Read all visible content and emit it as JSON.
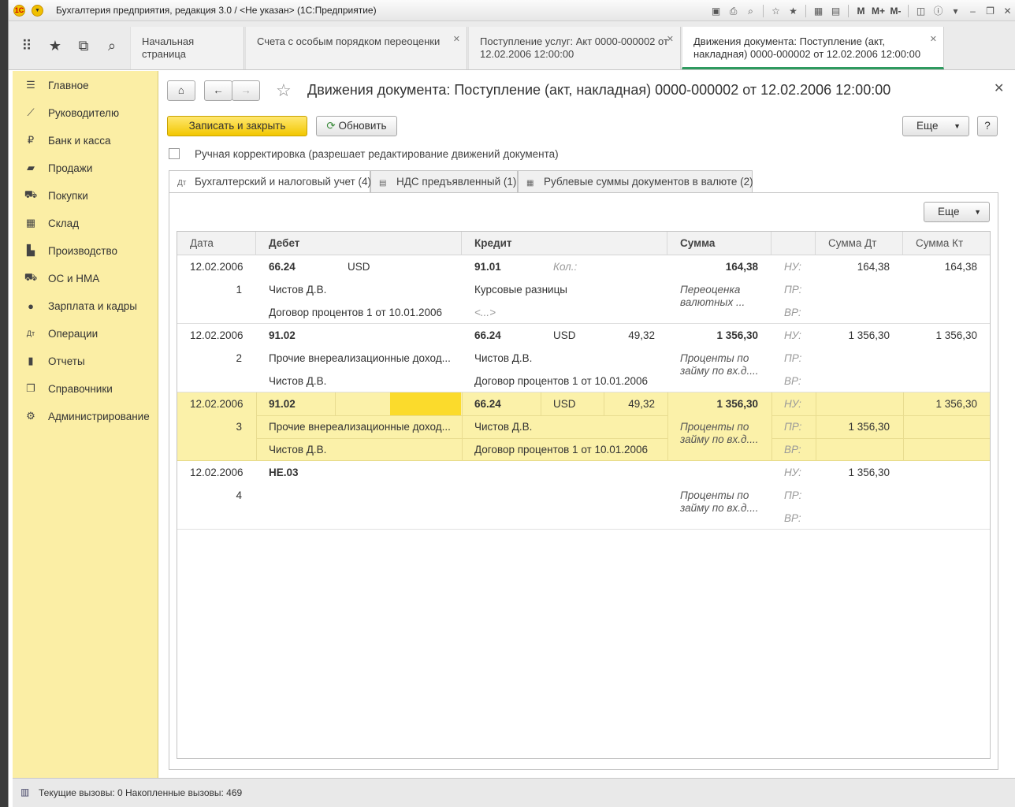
{
  "window": {
    "title": "Бухгалтерия предприятия, редакция 3.0 / <Не указан>  (1С:Предприятие)"
  },
  "toolbar_icons": [
    "M",
    "M+",
    "M-"
  ],
  "tabs": [
    {
      "label": "Начальная страница",
      "closable": false
    },
    {
      "label": "Счета с особым порядком переоценки",
      "closable": true
    },
    {
      "label": "Поступление услуг: Акт 0000-000002 от 12.02.2006 12:00:00",
      "closable": true
    },
    {
      "label": "Движения документа: Поступление (акт, накладная) 0000-000002 от 12.02.2006 12:00:00",
      "closable": true,
      "active": true
    }
  ],
  "sidebar": {
    "items": [
      {
        "label": "Главное",
        "icon": "menu-icon"
      },
      {
        "label": "Руководителю",
        "icon": "chart-line-icon"
      },
      {
        "label": "Банк и касса",
        "icon": "ruble-icon"
      },
      {
        "label": "Продажи",
        "icon": "bag-icon"
      },
      {
        "label": "Покупки",
        "icon": "cart-icon"
      },
      {
        "label": "Склад",
        "icon": "warehouse-icon"
      },
      {
        "label": "Производство",
        "icon": "factory-icon"
      },
      {
        "label": "ОС и НМА",
        "icon": "truck-icon"
      },
      {
        "label": "Зарплата и кадры",
        "icon": "person-icon"
      },
      {
        "label": "Операции",
        "icon": "dt-kt-icon"
      },
      {
        "label": "Отчеты",
        "icon": "bar-chart-icon"
      },
      {
        "label": "Справочники",
        "icon": "books-icon"
      },
      {
        "label": "Администрирование",
        "icon": "gear-icon"
      }
    ]
  },
  "document": {
    "title": "Движения документа: Поступление (акт, накладная) 0000-000002 от 12.02.2006 12:00:00",
    "save_close_label": "Записать и закрыть",
    "refresh_label": "Обновить",
    "more_label": "Еще",
    "help_label": "?",
    "manual_edit_label": "Ручная корректировка (разрешает редактирование движений документа)"
  },
  "form_tabs": [
    {
      "label": "Бухгалтерский и налоговый учет (4)",
      "icon": "dt-kt-icon"
    },
    {
      "label": "НДС предъявленный (1)",
      "icon": "register-icon"
    },
    {
      "label": "Рублевые суммы документов в валюте (2)",
      "icon": "table-icon"
    }
  ],
  "panel": {
    "more_label": "Еще"
  },
  "grid": {
    "headers": {
      "date": "Дата",
      "debit": "Дебет",
      "credit": "Кредит",
      "sum": "Сумма",
      "sum_dt": "Сумма Дт",
      "sum_kt": "Сумма Кт"
    },
    "rows": [
      {
        "date": "12.02.2006",
        "num": "1",
        "debit_account": "66.24",
        "debit_cur": "USD",
        "debit_amount": "",
        "debit_sub1": "Чистов Д.В.",
        "debit_sub2": "Договор процентов 1 от 10.01.2006",
        "credit_account": "91.01",
        "credit_cur": "Кол.:",
        "credit_amount": "",
        "credit_sub1": "Курсовые разницы",
        "credit_sub2": "<...>",
        "sum": "164,38",
        "content": "Переоценка валютных ...",
        "nu": "НУ:",
        "pr": "ПР:",
        "vr": "ВР:",
        "nu_dt": "164,38",
        "nu_kt": "164,38",
        "pr_dt": "",
        "pr_kt": ""
      },
      {
        "date": "12.02.2006",
        "num": "2",
        "debit_account": "91.02",
        "debit_cur": "",
        "debit_amount": "",
        "debit_sub1": "Прочие внереализационные доход...",
        "debit_sub2": "Чистов Д.В.",
        "credit_account": "66.24",
        "credit_cur": "USD",
        "credit_amount": "49,32",
        "credit_sub1": "Чистов Д.В.",
        "credit_sub2": "Договор процентов 1 от 10.01.2006",
        "sum": "1 356,30",
        "content": "Проценты по займу по вх.д....",
        "nu": "НУ:",
        "pr": "ПР:",
        "vr": "ВР:",
        "nu_dt": "1 356,30",
        "nu_kt": "1 356,30",
        "pr_dt": "",
        "pr_kt": ""
      },
      {
        "date": "12.02.2006",
        "num": "3",
        "debit_account": "91.02",
        "debit_cur": "",
        "debit_amount": "",
        "debit_sub1": "Прочие внереализационные доход...",
        "debit_sub2": "Чистов Д.В.",
        "credit_account": "66.24",
        "credit_cur": "USD",
        "credit_amount": "49,32",
        "credit_sub1": "Чистов Д.В.",
        "credit_sub2": "Договор процентов 1 от 10.01.2006",
        "sum": "1 356,30",
        "content": "Проценты по займу по вх.д....",
        "nu": "НУ:",
        "pr": "ПР:",
        "vr": "ВР:",
        "nu_dt": "",
        "nu_kt": "1 356,30",
        "pr_dt": "1 356,30",
        "pr_kt": ""
      },
      {
        "date": "12.02.2006",
        "num": "4",
        "debit_account": "НЕ.03",
        "debit_cur": "",
        "debit_amount": "",
        "debit_sub1": "",
        "debit_sub2": "",
        "credit_account": "",
        "credit_cur": "",
        "credit_amount": "",
        "credit_sub1": "",
        "credit_sub2": "",
        "sum": "",
        "content": "Проценты по займу по вх.д....",
        "nu": "НУ:",
        "pr": "ПР:",
        "vr": "ВР:",
        "nu_dt": "1 356,30",
        "nu_kt": "",
        "pr_dt": "",
        "pr_kt": ""
      }
    ]
  },
  "status": {
    "text": "Текущие вызовы: 0   Накопленные вызовы: 469"
  }
}
